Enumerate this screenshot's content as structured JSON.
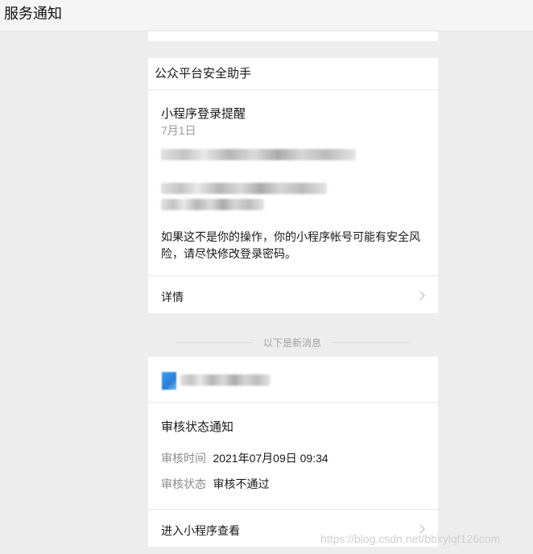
{
  "window": {
    "title": "服务通知"
  },
  "card1": {
    "sender": "公众平台安全助手",
    "message_title": "小程序登录提醒",
    "date": "7月1日",
    "body": "如果这不是你的操作，你的小程序帐号可能有安全风险，请尽快修改登录密码。",
    "details_label": "详情"
  },
  "separator": {
    "label": "以下是新消息"
  },
  "card2": {
    "notification_title": "审核状态通知",
    "fields": [
      {
        "label": "审核时间",
        "value": "2021年07月09日 09:34"
      },
      {
        "label": "审核状态",
        "value": "审核不通过"
      }
    ],
    "link_label": "进入小程序查看"
  },
  "watermark": "https://blog.csdn.net/bbxylqf126com",
  "colors": {
    "background": "#ededed",
    "card": "#ffffff",
    "muted": "#9a9a9a"
  }
}
